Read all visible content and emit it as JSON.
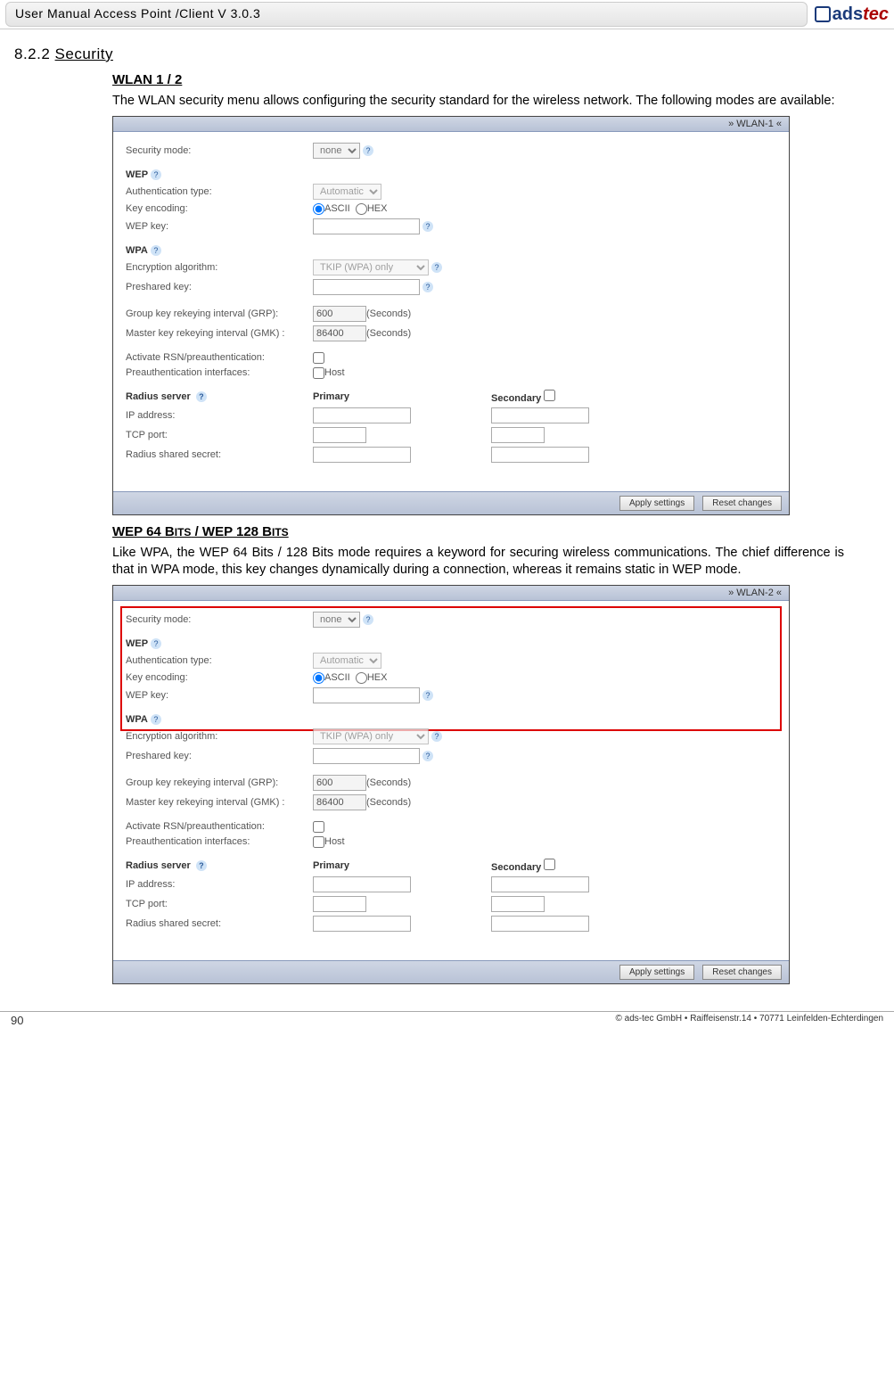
{
  "header": {
    "title": "User Manual Access Point /Client V 3.0.3",
    "logo_text1": "ads",
    "logo_text2": "tec"
  },
  "section": {
    "number": "8.2.2",
    "title": "Security"
  },
  "wlan_heading": "WLAN 1 / 2",
  "intro_para": "The WLAN security menu allows configuring the security standard for the wireless network. The following modes are available:",
  "wep_heading_prefix": "WEP 64 B",
  "wep_heading_sc1": "ITS",
  "wep_heading_mid": " / WEP 128 B",
  "wep_heading_sc2": "ITS",
  "wep_para": "Like WPA, the WEP 64 Bits / 128 Bits mode requires a keyword for securing wireless communications. The chief difference is that in WPA mode, this key changes dynamically during a connection, whereas it remains static in WEP mode.",
  "panel": {
    "head1": "» WLAN-1 «",
    "head2": "» WLAN-2 «",
    "security_mode_lbl": "Security mode:",
    "security_mode_val": "none",
    "wep_section": "WEP",
    "auth_type_lbl": "Authentication type:",
    "auth_type_val": "Automatic",
    "key_enc_lbl": "Key encoding:",
    "key_enc_ascii": "ASCII",
    "key_enc_hex": "HEX",
    "wep_key_lbl": "WEP key:",
    "wpa_section": "WPA",
    "enc_alg_lbl": "Encryption algorithm:",
    "enc_alg_val": "TKIP (WPA) only",
    "psk_lbl": "Preshared key:",
    "grp_lbl": "Group key rekeying interval (GRP):",
    "grp_val": "600",
    "gmk_lbl": "Master key rekeying interval (GMK) :",
    "gmk_val": "86400",
    "seconds": "(Seconds)",
    "rsn_lbl": "Activate RSN/preauthentication:",
    "preauth_if_lbl": "Preauthentication interfaces:",
    "host": "Host",
    "radius_section": "Radius server",
    "primary": "Primary",
    "secondary": "Secondary",
    "ip_lbl": "IP address:",
    "tcp_lbl": "TCP port:",
    "rad_secret_lbl": "Radius shared secret:",
    "btn_apply": "Apply settings",
    "btn_reset": "Reset changes"
  },
  "footer": {
    "page": "90",
    "copyright": "© ads-tec GmbH • Raiffeisenstr.14 • 70771 Leinfelden-Echterdingen"
  }
}
